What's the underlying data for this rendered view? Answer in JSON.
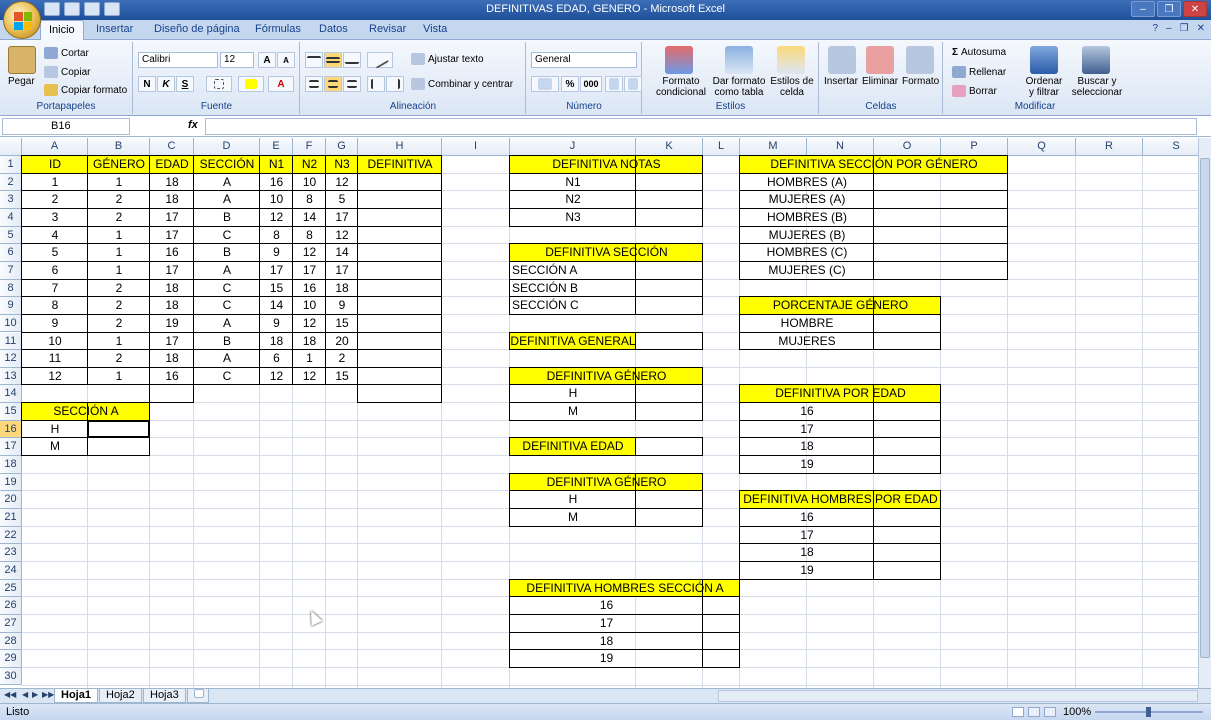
{
  "window": {
    "title": "DEFINITIVAS EDAD, GENERO - Microsoft Excel",
    "minimize": "–",
    "restore": "❐",
    "close": "✕"
  },
  "help": {
    "help_icon": "?",
    "min": "–",
    "restore": "❐",
    "close": "✕"
  },
  "tabs": [
    "Inicio",
    "Insertar",
    "Diseño de página",
    "Fórmulas",
    "Datos",
    "Revisar",
    "Vista"
  ],
  "ribbon": {
    "paste": "Pegar",
    "cut": "Cortar",
    "copy": "Copiar",
    "format_painter": "Copiar formato",
    "clipboard_group": "Portapapeles",
    "font_name": "Calibri",
    "font_size": "12",
    "grow": "A",
    "shrink": "A",
    "bold": "N",
    "italic": "K",
    "underline": "S",
    "font_group": "Fuente",
    "wrap": "Ajustar texto",
    "merge": "Combinar y centrar",
    "align_group": "Alineación",
    "number_format": "General",
    "percent": "%",
    "thousands": "000",
    "number_group": "Número",
    "cond_format": "Formato condicional",
    "format_table": "Dar formato como tabla",
    "cell_styles": "Estilos de celda",
    "styles_group": "Estilos",
    "insert": "Insertar",
    "delete": "Eliminar",
    "format": "Formato",
    "cells_group": "Celdas",
    "autosum": "Autosuma",
    "fill": "Rellenar",
    "clear": "Borrar",
    "sort": "Ordenar y filtrar",
    "find": "Buscar y seleccionar",
    "edit_group": "Modificar"
  },
  "formula_bar": {
    "name_box": "B16",
    "fx": "fx",
    "content": ""
  },
  "columns": [
    "A",
    "B",
    "C",
    "D",
    "E",
    "F",
    "G",
    "H",
    "I",
    "J",
    "K",
    "L",
    "M",
    "N",
    "O",
    "P",
    "Q",
    "R",
    "S"
  ],
  "rows": [
    "1",
    "2",
    "3",
    "4",
    "5",
    "6",
    "7",
    "8",
    "9",
    "10",
    "11",
    "12",
    "13",
    "14",
    "15",
    "16",
    "17",
    "18",
    "19",
    "20",
    "21",
    "22",
    "23",
    "24",
    "25",
    "26",
    "27",
    "28",
    "29",
    "30"
  ],
  "main_table": {
    "headers": [
      "ID",
      "GÉNERO",
      "EDAD",
      "SECCIÓN",
      "N1",
      "N2",
      "N3",
      "DEFINITIVA"
    ],
    "rows": [
      [
        "1",
        "1",
        "18",
        "A",
        "16",
        "10",
        "12"
      ],
      [
        "2",
        "2",
        "18",
        "A",
        "10",
        "8",
        "5"
      ],
      [
        "3",
        "2",
        "17",
        "B",
        "12",
        "14",
        "17"
      ],
      [
        "4",
        "1",
        "17",
        "C",
        "8",
        "8",
        "12"
      ],
      [
        "5",
        "1",
        "16",
        "B",
        "9",
        "12",
        "14"
      ],
      [
        "6",
        "1",
        "17",
        "A",
        "17",
        "17",
        "17"
      ],
      [
        "7",
        "2",
        "18",
        "C",
        "15",
        "16",
        "18"
      ],
      [
        "8",
        "2",
        "18",
        "C",
        "14",
        "10",
        "9"
      ],
      [
        "9",
        "2",
        "19",
        "A",
        "9",
        "12",
        "15"
      ],
      [
        "10",
        "1",
        "17",
        "B",
        "18",
        "18",
        "20"
      ],
      [
        "11",
        "2",
        "18",
        "A",
        "6",
        "1",
        "2"
      ],
      [
        "12",
        "1",
        "16",
        "C",
        "12",
        "12",
        "15"
      ]
    ]
  },
  "seccion_a": {
    "title": "SECCIÓN A",
    "rows": [
      "H",
      "M"
    ]
  },
  "def_notas": {
    "title": "DEFINITIVA NOTAS",
    "rows": [
      "N1",
      "N2",
      "N3"
    ]
  },
  "def_seccion": {
    "title": "DEFINITIVA SECCIÓN",
    "rows": [
      "SECCIÓN A",
      "SECCIÓN B",
      "SECCIÓN C"
    ]
  },
  "def_general": {
    "title": "DEFINITIVA GENERAL"
  },
  "def_genero1": {
    "title": "DEFINITIVA GÉNERO",
    "rows": [
      "H",
      "M"
    ]
  },
  "def_edad": {
    "title": "DEFINITIVA EDAD"
  },
  "def_genero2": {
    "title": "DEFINITIVA GÉNERO",
    "rows": [
      "H",
      "M"
    ]
  },
  "def_hombres_seccion_a": {
    "title": "DEFINITIVA HOMBRES SECCIÓN A",
    "rows": [
      "16",
      "17",
      "18",
      "19"
    ]
  },
  "def_seccion_genero": {
    "title": "DEFINITIVA SECCIÓN POR GÉNERO",
    "rows": [
      "HOMBRES (A)",
      "MUJERES (A)",
      "HOMBRES (B)",
      "MUJERES (B)",
      "HOMBRES (C)",
      "MUJERES (C)"
    ]
  },
  "porcentaje_genero": {
    "title": "PORCENTAJE GÉNERO",
    "rows": [
      "HOMBRE",
      "MUJERES"
    ]
  },
  "def_por_edad": {
    "title": "DEFINITIVA POR EDAD",
    "rows": [
      "16",
      "17",
      "18",
      "19"
    ]
  },
  "def_hombres_edad": {
    "title": "DEFINITIVA HOMBRES POR EDAD",
    "rows": [
      "16",
      "17",
      "18",
      "19"
    ]
  },
  "sheets": [
    "Hoja1",
    "Hoja2",
    "Hoja3"
  ],
  "status": {
    "ready": "Listo",
    "zoom": "100%"
  },
  "colors": {
    "highlight": "#ffff00",
    "title_bar": "#2b5ca8"
  }
}
